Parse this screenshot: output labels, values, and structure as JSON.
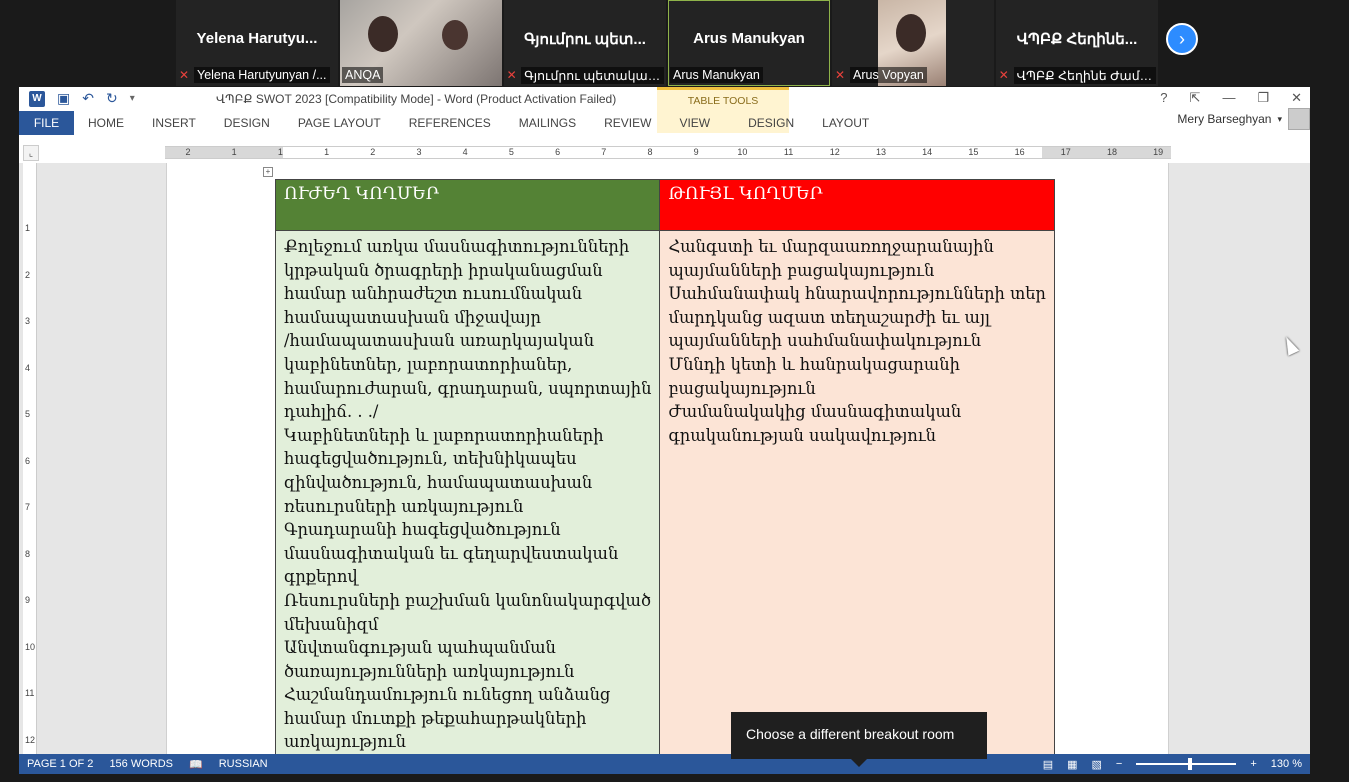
{
  "participants": [
    {
      "name": "Yelena  Harutyu...",
      "label": "Yelena Harutyunyan /...",
      "muted": true,
      "video": false
    },
    {
      "name": "",
      "label": "ANQA",
      "muted": false,
      "video": true
    },
    {
      "name": "Գյումրու  պետ...",
      "label": "Գյումրու պետական ...",
      "muted": true,
      "video": false
    },
    {
      "name": "Arus Manukyan",
      "label": "Arus Manukyan",
      "muted": false,
      "video": false,
      "active": true
    },
    {
      "name": "",
      "label": "Arus Vopyan",
      "muted": true,
      "video": true
    },
    {
      "name": "ՎՊԲՔ  Հեղինե...",
      "label": "ՎՊԲՔ Հեղինե Ժամհ...",
      "muted": true,
      "video": false
    }
  ],
  "word": {
    "title": "ՎՊԲՔ SWOT 2023 [Compatibility Mode] - Word (Product Activation Failed)",
    "table_tools": "TABLE TOOLS",
    "tabs": [
      "FILE",
      "HOME",
      "INSERT",
      "DESIGN",
      "PAGE LAYOUT",
      "REFERENCES",
      "MAILINGS",
      "REVIEW",
      "VIEW"
    ],
    "context_tabs": [
      "DESIGN",
      "LAYOUT"
    ],
    "user": "Mery Barseghyan",
    "help": "?",
    "ruler_numbers": [
      "2",
      "1",
      "1",
      "1",
      "2",
      "3",
      "4",
      "5",
      "6",
      "7",
      "8",
      "9",
      "10",
      "11",
      "12",
      "13",
      "14",
      "15",
      "16",
      "17",
      "18",
      "19"
    ],
    "vruler_numbers": [
      "1",
      "2",
      "3",
      "4",
      "5",
      "6",
      "7",
      "8",
      "9",
      "10",
      "11",
      "12"
    ]
  },
  "document": {
    "strengths_header": "ՈՒԺԵՂ ԿՈՂՄԵՐ",
    "weaknesses_header": "ԹՈՒՅԼ ԿՈՂՄԵՐ",
    "strengths_lines": [
      "Քոլեջում առկա մասնագիտությունների",
      "կրթական ծրագրերի իրականացման",
      "համար անհրաժեշտ ուսումնական",
      "համապատասխան միջավայր",
      "/համապատասխան առարկայական",
      "կաբինետներ, լաբորատորիաներ,",
      "համարուժարան, գրադարան, սպորտային",
      "դահլիճ. . ./",
      "Կաբինետների և լաբորատորիաների",
      "հագեցվածություն, տեխնիկապես",
      "զինվածություն, համապատասխան",
      "ռեսուրսների առկայություն",
      "Գրադարանի հագեցվածություն",
      "մասնագիտական եւ գեղարվեստական",
      "գրքերով",
      "Ռեսուրսների բաշխման կանոնակարգված",
      "մեխանիզմ",
      "Անվտանգության պահպանման",
      "ծառայությունների առկայություն",
      "Հաշմանդամություն ունեցող անձանց",
      "համար մուտքի թեքահարթակների",
      "առկայություն"
    ],
    "weaknesses_lines": [
      "Հանգստի եւ մարզաառողջարանային",
      "պայմանների բացակայություն",
      "Սահմանափակ հնարավորությունների տեր",
      "մարդկանց ազատ տեղաշարժի եւ այլ",
      "պայմանների սահմանափակություն",
      "Մննդի կետի և հանրակացարանի",
      "բացակայություն",
      "Ժամանակակից մասնագիտական",
      "գրականության սակավություն"
    ]
  },
  "status": {
    "page": "PAGE 1 OF 2",
    "words": "156 WORDS",
    "language": "RUSSIAN",
    "zoom": "130 %",
    "zoom_value_percent": 130
  },
  "tooltip": "Choose a different breakout room",
  "colors": {
    "word_blue": "#2b579a",
    "strengths_header": "#548235",
    "weaknesses_header": "#ff0000",
    "strengths_body": "#e2efda",
    "weaknesses_body": "#fce4d6",
    "zoom_blue": "#2d8cff"
  }
}
